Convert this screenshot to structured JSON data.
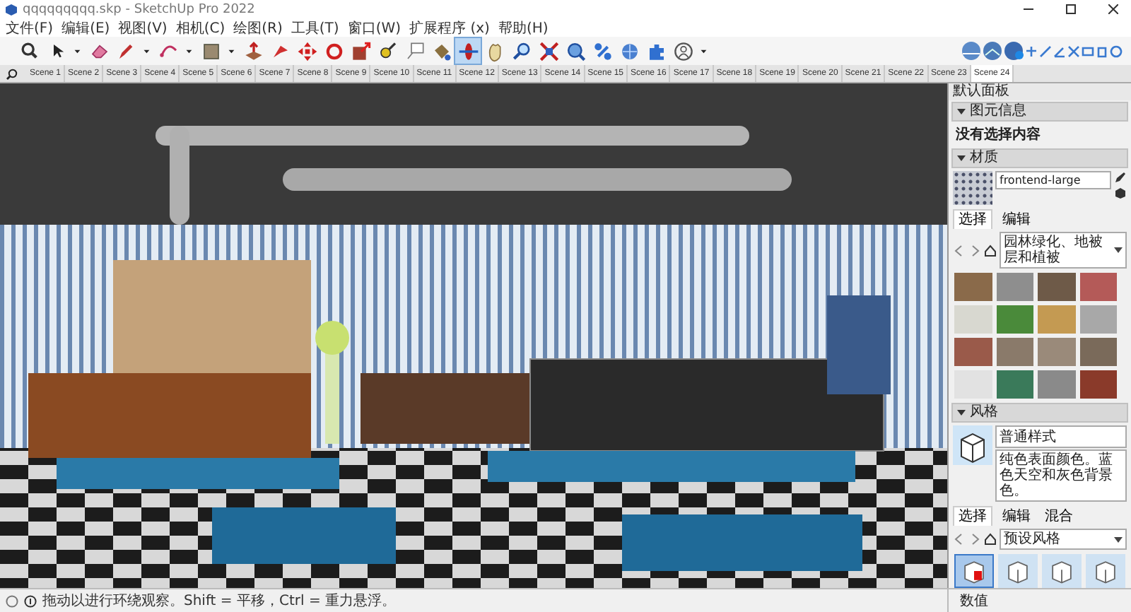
{
  "window": {
    "title": "qqqqqqqqq.skp - SketchUp Pro 2022"
  },
  "menu": [
    "文件(F)",
    "编辑(E)",
    "视图(V)",
    "相机(C)",
    "绘图(R)",
    "工具(T)",
    "窗口(W)",
    "扩展程序 (x)",
    "帮助(H)"
  ],
  "toolbar": {
    "tools": [
      {
        "kind": "zoom",
        "selected": false
      },
      {
        "kind": "select",
        "selected": false
      },
      {
        "kind": "caret",
        "selected": false
      },
      {
        "kind": "eraser",
        "selected": false
      },
      {
        "kind": "pencil",
        "selected": false
      },
      {
        "kind": "caret",
        "selected": false
      },
      {
        "kind": "arc",
        "selected": false
      },
      {
        "kind": "caret",
        "selected": false
      },
      {
        "kind": "rect",
        "selected": false
      },
      {
        "kind": "caret",
        "selected": false
      },
      {
        "kind": "push",
        "selected": false
      },
      {
        "kind": "follow",
        "selected": false
      },
      {
        "kind": "move",
        "selected": false
      },
      {
        "kind": "rotate",
        "selected": false
      },
      {
        "kind": "scale",
        "selected": false
      },
      {
        "kind": "tape",
        "selected": false
      },
      {
        "kind": "text",
        "selected": false
      },
      {
        "kind": "paint",
        "selected": false
      },
      {
        "kind": "orbit",
        "selected": true
      },
      {
        "kind": "pan",
        "selected": false
      },
      {
        "kind": "zoomtool",
        "selected": false
      },
      {
        "kind": "extents",
        "selected": false
      },
      {
        "kind": "warehouse",
        "selected": false
      },
      {
        "kind": "share",
        "selected": false
      },
      {
        "kind": "upload",
        "selected": false
      },
      {
        "kind": "extension",
        "selected": false
      },
      {
        "kind": "person",
        "selected": false
      },
      {
        "kind": "caret",
        "selected": false
      }
    ]
  },
  "scenes": [
    {
      "label": "Scene 1",
      "selected": false
    },
    {
      "label": "Scene 2",
      "selected": false
    },
    {
      "label": "Scene 3",
      "selected": false
    },
    {
      "label": "Scene 4",
      "selected": false
    },
    {
      "label": "Scene 5",
      "selected": false
    },
    {
      "label": "Scene 6",
      "selected": false
    },
    {
      "label": "Scene 7",
      "selected": false
    },
    {
      "label": "Scene 8",
      "selected": false
    },
    {
      "label": "Scene 9",
      "selected": false
    },
    {
      "label": "Scene 10",
      "selected": false
    },
    {
      "label": "Scene 11",
      "selected": false
    },
    {
      "label": "Scene 12",
      "selected": false
    },
    {
      "label": "Scene 13",
      "selected": false
    },
    {
      "label": "Scene 14",
      "selected": false
    },
    {
      "label": "Scene 15",
      "selected": false
    },
    {
      "label": "Scene 16",
      "selected": false
    },
    {
      "label": "Scene 17",
      "selected": false
    },
    {
      "label": "Scene 18",
      "selected": false
    },
    {
      "label": "Scene 19",
      "selected": false
    },
    {
      "label": "Scene 20",
      "selected": false
    },
    {
      "label": "Scene 21",
      "selected": false
    },
    {
      "label": "Scene 22",
      "selected": false
    },
    {
      "label": "Scene 23",
      "selected": false
    },
    {
      "label": "Scene 24",
      "selected": true
    }
  ],
  "tray": {
    "title": "默认面板",
    "entity_info": {
      "title": "图元信息",
      "expanded": true,
      "text": "没有选择内容"
    },
    "materials": {
      "title": "材质",
      "expanded": true,
      "name": "frontend-large",
      "tabs": [
        {
          "label": "选择",
          "selected": true
        },
        {
          "label": "编辑",
          "selected": false
        }
      ],
      "library": "园林绿化、地被层和植被",
      "swatches": [
        {
          "color": "#8a6a4a"
        },
        {
          "color": "#8e8e8e"
        },
        {
          "color": "#6e5a48"
        },
        {
          "color": "#b45a58"
        },
        {
          "color": "#d8d8d0"
        },
        {
          "color": "#4a8a3a"
        },
        {
          "color": "#c49a52"
        },
        {
          "color": "#a8a8a8"
        },
        {
          "color": "#9a5a4a"
        },
        {
          "color": "#8a7a6a"
        },
        {
          "color": "#9a8a7a"
        },
        {
          "color": "#7a6a5a"
        },
        {
          "color": "#e2e2e2"
        },
        {
          "color": "#3a7a5a"
        },
        {
          "color": "#8a8a8a"
        },
        {
          "color": "#8a3a2a"
        }
      ]
    },
    "styles": {
      "title": "风格",
      "expanded": true,
      "name": "普通样式",
      "description": "纯色表面颜色。蓝色天空和灰色背景色。",
      "tabs": [
        {
          "label": "选择",
          "selected": true
        },
        {
          "label": "编辑",
          "selected": false
        },
        {
          "label": "混合",
          "selected": false
        }
      ],
      "collection": "预设风格",
      "thumbnails": [
        {
          "selected": true
        },
        {
          "selected": false
        },
        {
          "selected": false
        },
        {
          "selected": false
        }
      ]
    }
  },
  "status_bar": {
    "hint": "拖动以进行环绕观察。Shift = 平移，Ctrl = 重力悬浮。",
    "measurements_label": "数值"
  }
}
